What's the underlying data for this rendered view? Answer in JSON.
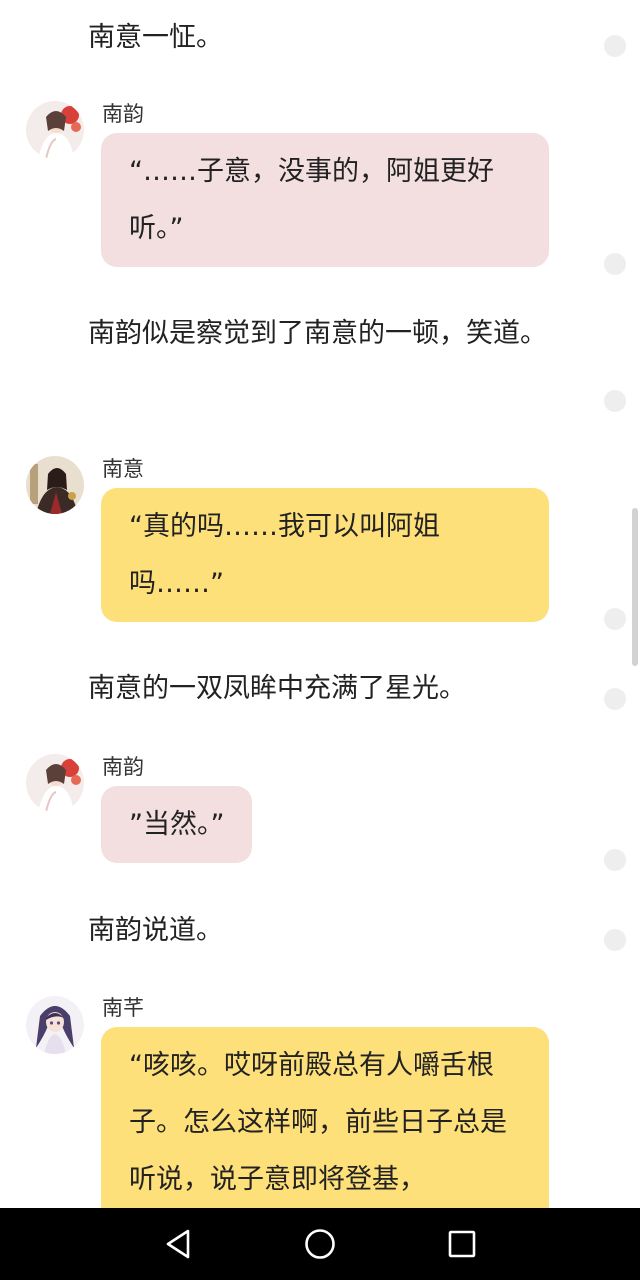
{
  "messages": [
    {
      "type": "narration",
      "text": "南意一怔。"
    },
    {
      "type": "dialogue",
      "speaker": "南韵",
      "avatar": "girl-white-red-flowers-avatar",
      "text": "“……子意，没事的，阿姐更好听。”"
    },
    {
      "type": "narration",
      "text": "南韵似是察觉到了南意的一顿，笑道。"
    },
    {
      "type": "dialogue",
      "speaker": "南意",
      "avatar": "boy-dark-robe-avatar",
      "text": "“真的吗……我可以叫阿姐吗……”"
    },
    {
      "type": "narration",
      "text": "南意的一双凤眸中充满了星光。"
    },
    {
      "type": "dialogue",
      "speaker": "南韵",
      "avatar": "girl-white-red-flowers-avatar",
      "text": "”当然。”"
    },
    {
      "type": "narration",
      "text": "南韵说道。"
    },
    {
      "type": "dialogue",
      "speaker": "南芊",
      "avatar": "girl-purple-hair-avatar",
      "text": "“咳咳。哎呀前殿总有人嚼舌根子。怎么这样啊，前些日子总是听说，说子意即将登基，"
    }
  ],
  "nav": {
    "back": "back-triangle-icon",
    "home": "home-circle-icon",
    "recents": "recents-square-icon"
  },
  "colors": {
    "bubble_pink": "#f3dfe0",
    "bubble_yellow": "#fde07a",
    "navbar": "#000000"
  }
}
